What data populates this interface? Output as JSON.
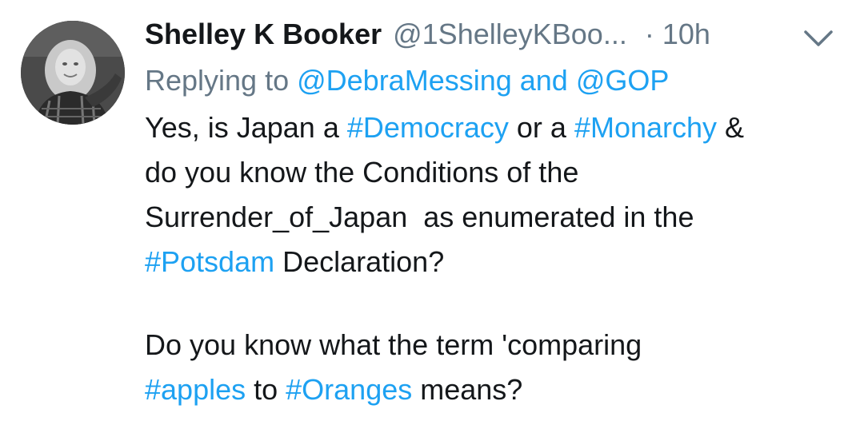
{
  "author": {
    "name": "Shelley K Booker",
    "handle": "@1ShelleyKBoo...",
    "separator": "·",
    "time": "10h"
  },
  "reply": {
    "prefix": "Replying to ",
    "user1": "@DebraMessing",
    "conjunction": " and ",
    "user2": "@GOP"
  },
  "body": {
    "l1_a": "Yes, is Japan a ",
    "l1_tag1": "#Democracy",
    "l1_b": " or a ",
    "l1_tag2": "#Monarchy",
    "l1_c": " &",
    "l2": "do you know the Conditions of the",
    "l3": "Surrender_of_Japan  as enumerated in the",
    "l4_tag": "#Potsdam",
    "l4_b": " Declaration?",
    "l5": "Do you know what the term 'comparing",
    "l6_tag1": "#apples",
    "l6_b": " to ",
    "l6_tag2": "#Oranges",
    "l6_c": " means?"
  },
  "icons": {
    "avatar": "profile-photo",
    "menu": "chevron-down-icon"
  },
  "colors": {
    "link": "#1da1f2",
    "text": "#14171a",
    "secondary": "#657786"
  }
}
